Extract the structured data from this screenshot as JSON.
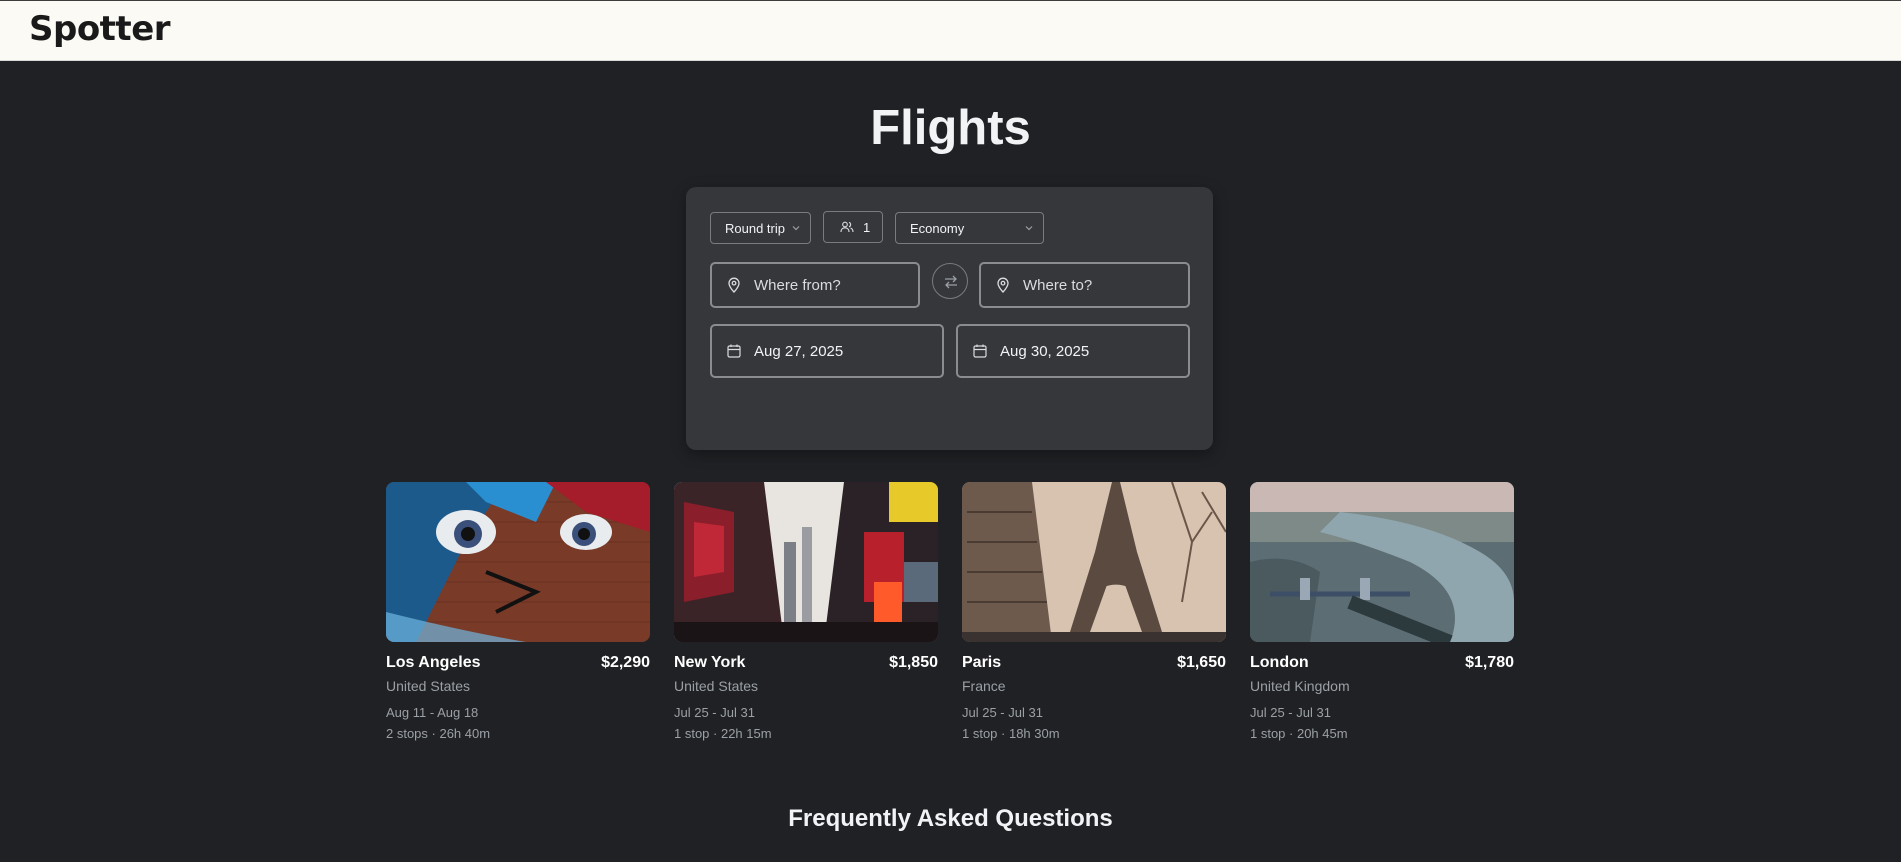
{
  "app": {
    "logo_text": "Spotter"
  },
  "page": {
    "title": "Flights"
  },
  "search": {
    "trip_type": "Round trip",
    "passengers": "1",
    "cabin_class": "Economy",
    "from_placeholder": "Where from?",
    "to_placeholder": "Where to?",
    "depart_date": "Aug 27, 2025",
    "return_date": "Aug 30, 2025"
  },
  "destinations": [
    {
      "city": "Los Angeles",
      "country": "United States",
      "price": "$2,290",
      "dates": "Aug 11 - Aug 18",
      "stops": "2 stops · 26h 40m"
    },
    {
      "city": "New York",
      "country": "United States",
      "price": "$1,850",
      "dates": "Jul 25 - Jul 31",
      "stops": "1 stop · 22h 15m"
    },
    {
      "city": "Paris",
      "country": "France",
      "price": "$1,650",
      "dates": "Jul 25 - Jul 31",
      "stops": "1 stop · 18h 30m"
    },
    {
      "city": "London",
      "country": "United Kingdom",
      "price": "$1,780",
      "dates": "Jul 25 - Jul 31",
      "stops": "1 stop · 20h 45m"
    }
  ],
  "faq": {
    "title": "Frequently Asked Questions"
  },
  "icons": {
    "passengers": "people-icon",
    "location": "map-pin-icon",
    "swap": "swap-arrows-icon",
    "calendar": "calendar-icon",
    "dropdown": "chevron-down-icon"
  },
  "colors": {
    "background": "#202124",
    "header": "#fbfaf5",
    "card": "#36373a",
    "muted_text": "#9aa0a6"
  }
}
